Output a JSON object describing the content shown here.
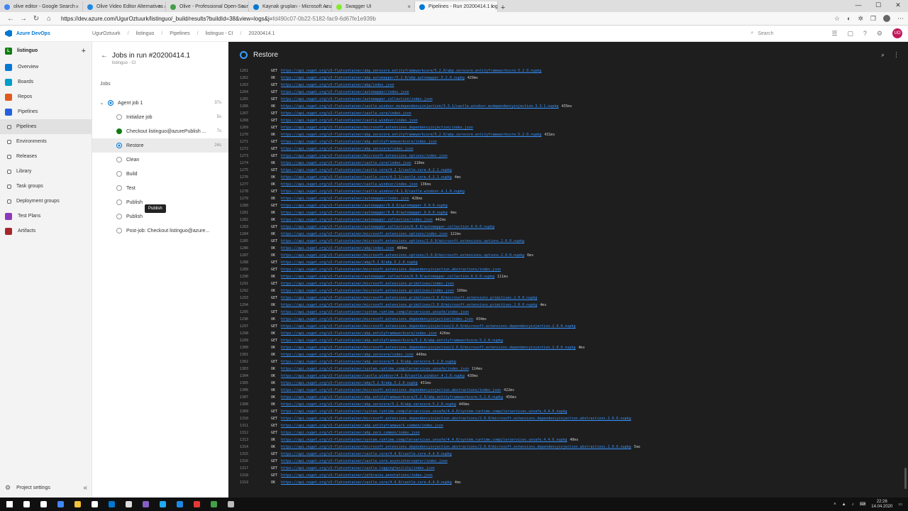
{
  "browser": {
    "tabs": [
      {
        "title": "olive editor - Google Search",
        "color": "#4285f4",
        "active": false
      },
      {
        "title": "Olive Video Editor Alternatives and...",
        "color": "#1e88e5",
        "active": false
      },
      {
        "title": "Olive - Professional Open-Source V...",
        "color": "#43a047",
        "active": false
      },
      {
        "title": "Kaynak grupları - Microsoft Azure",
        "color": "#0078d4",
        "active": false
      },
      {
        "title": "Swagger UI",
        "color": "#85ea2d",
        "active": false
      },
      {
        "title": "Pipelines - Run 20200414.1 logs",
        "color": "#0078d4",
        "active": true
      }
    ],
    "url_main": "https://dev.azure.com/UgurOztuurk/listinguo/_build/results?buildId=38&view=logs&j=",
    "url_rest": "fd490c07-0b22-5182-fac9-6d67fe1e939b"
  },
  "header": {
    "brand": "Azure DevOps",
    "breadcrumbs": [
      "UgurOztuurk",
      "listinguo",
      "Pipelines",
      "listinguo - CI",
      "20200414.1"
    ],
    "search_placeholder": "Search",
    "user_initials": "UO"
  },
  "leftnav": {
    "project_initial": "L",
    "project_name": "listinguo",
    "items": [
      {
        "label": "Overview",
        "color": "#0078d4",
        "sub": false,
        "selected": false
      },
      {
        "label": "Boards",
        "color": "#009ccc",
        "sub": false,
        "selected": false
      },
      {
        "label": "Repos",
        "color": "#e05b1f",
        "sub": false,
        "selected": false
      },
      {
        "label": "Pipelines",
        "color": "#2560e0",
        "sub": false,
        "selected": false
      },
      {
        "label": "Pipelines",
        "color": "#2560e0",
        "sub": true,
        "selected": true
      },
      {
        "label": "Environments",
        "color": "#555",
        "sub": true,
        "selected": false
      },
      {
        "label": "Releases",
        "color": "#555",
        "sub": true,
        "selected": false
      },
      {
        "label": "Library",
        "color": "#555",
        "sub": true,
        "selected": false
      },
      {
        "label": "Task groups",
        "color": "#555",
        "sub": true,
        "selected": false
      },
      {
        "label": "Deployment groups",
        "color": "#555",
        "sub": true,
        "selected": false
      },
      {
        "label": "Test Plans",
        "color": "#8a3ab9",
        "sub": false,
        "selected": false
      },
      {
        "label": "Artifacts",
        "color": "#a4262c",
        "sub": false,
        "selected": false
      }
    ],
    "project_settings": "Project settings"
  },
  "jobs": {
    "title": "Jobs in run #20200414.1",
    "subtitle": "listinguo - CI",
    "section_label": "Jobs",
    "agent_job": {
      "label": "Agent job 1",
      "duration": "37s"
    },
    "steps": [
      {
        "label": "Initialize job",
        "status": "skip",
        "duration": "5s",
        "selected": false
      },
      {
        "label": "Checkout listinguo@azurePublish ...",
        "status": "ok",
        "duration": "7s",
        "selected": false
      },
      {
        "label": "Restore",
        "status": "run",
        "duration": "24s",
        "selected": true
      },
      {
        "label": "Clean",
        "status": "pending",
        "duration": "",
        "selected": false
      },
      {
        "label": "Build",
        "status": "pending",
        "duration": "",
        "selected": false
      },
      {
        "label": "Test",
        "status": "pending",
        "duration": "",
        "selected": false
      },
      {
        "label": "Publish",
        "status": "pending",
        "duration": "",
        "selected": false
      },
      {
        "label": "Publish",
        "status": "pending",
        "duration": "",
        "selected": false
      },
      {
        "label": "Post-job: Checkout listinguo@azure...",
        "status": "pending",
        "duration": "",
        "selected": false
      }
    ],
    "tooltip": "Publish"
  },
  "log": {
    "title": "Restore",
    "lines": [
      {
        "n": "1261",
        "v": "GET",
        "u": "https://api.nuget.org/v3-flatcontainer/abp.zerocore.entityframeworkcore/5.2.0/abp.zerocore.entityframeworkcore.5.2.0.nupkg",
        "t": ""
      },
      {
        "n": "1262",
        "v": "OK",
        "u": "https://api.nuget.org/v3-flatcontainer/abp.automapper/5.2.0/abp.automapper.5.2.0.nupkg",
        "t": "429ms"
      },
      {
        "n": "1263",
        "v": "GET",
        "u": "https://api.nuget.org/v3-flatcontainer/abp/index.json",
        "t": ""
      },
      {
        "n": "1264",
        "v": "GET",
        "u": "https://api.nuget.org/v3-flatcontainer/automapper/index.json",
        "t": ""
      },
      {
        "n": "1265",
        "v": "GET",
        "u": "https://api.nuget.org/v3-flatcontainer/automapper.collection/index.json",
        "t": ""
      },
      {
        "n": "1266",
        "v": "OK",
        "u": "https://api.nuget.org/v3-flatcontainer/castle.windsor.msdependencyinjection/3.3.1/castle.windsor.msdependencyinjection.3.3.1.nupkg",
        "t": "435ms"
      },
      {
        "n": "1267",
        "v": "GET",
        "u": "https://api.nuget.org/v3-flatcontainer/castle.core/index.json",
        "t": ""
      },
      {
        "n": "1268",
        "v": "GET",
        "u": "https://api.nuget.org/v3-flatcontainer/castle.windsor/index.json",
        "t": ""
      },
      {
        "n": "1269",
        "v": "GET",
        "u": "https://api.nuget.org/v3-flatcontainer/microsoft.extensions.dependencyinjection/index.json",
        "t": ""
      },
      {
        "n": "1270",
        "v": "OK",
        "u": "https://api.nuget.org/v3-flatcontainer/abp.zerocore.entityframeworkcore/5.2.0/abp.zerocore.entityframeworkcore.5.2.0.nupkg",
        "t": "431ms"
      },
      {
        "n": "1271",
        "v": "GET",
        "u": "https://api.nuget.org/v3-flatcontainer/abp.entityframeworkcore/index.json",
        "t": ""
      },
      {
        "n": "1272",
        "v": "GET",
        "u": "https://api.nuget.org/v3-flatcontainer/abp.zerocore/index.json",
        "t": ""
      },
      {
        "n": "1273",
        "v": "GET",
        "u": "https://api.nuget.org/v3-flatcontainer/microsoft.extensions.options/index.json",
        "t": ""
      },
      {
        "n": "1274",
        "v": "OK",
        "u": "https://api.nuget.org/v3-flatcontainer/castle.core/index.json",
        "t": "110ms"
      },
      {
        "n": "1275",
        "v": "GET",
        "u": "https://api.nuget.org/v3-flatcontainer/castle.core/4.2.1/castle.core.4.2.1.nupkg",
        "t": ""
      },
      {
        "n": "1276",
        "v": "OK",
        "u": "https://api.nuget.org/v3-flatcontainer/castle.core/4.2.1/castle.core.4.2.1.nupkg",
        "t": "4ms"
      },
      {
        "n": "1277",
        "v": "OK",
        "u": "https://api.nuget.org/v3-flatcontainer/castle.windsor/index.json",
        "t": "136ms"
      },
      {
        "n": "1278",
        "v": "GET",
        "u": "https://api.nuget.org/v3-flatcontainer/castle.windsor/4.1.0/castle.windsor.4.1.0.nupkg",
        "t": ""
      },
      {
        "n": "1279",
        "v": "OK",
        "u": "https://api.nuget.org/v3-flatcontainer/automapper/index.json",
        "t": "428ms"
      },
      {
        "n": "1280",
        "v": "GET",
        "u": "https://api.nuget.org/v3-flatcontainer/automapper/9.0.0/automapper.9.0.0.nupkg",
        "t": ""
      },
      {
        "n": "1281",
        "v": "OK",
        "u": "https://api.nuget.org/v3-flatcontainer/automapper/9.0.0/automapper.9.0.0.nupkg",
        "t": "4ms"
      },
      {
        "n": "1282",
        "v": "OK",
        "u": "https://api.nuget.org/v3-flatcontainer/automapper.collection/index.json",
        "t": "442ms"
      },
      {
        "n": "1283",
        "v": "GET",
        "u": "https://api.nuget.org/v3-flatcontainer/automapper.collection/6.0.0/automapper.collection.6.0.0.nupkg",
        "t": ""
      },
      {
        "n": "1284",
        "v": "OK",
        "u": "https://api.nuget.org/v3-flatcontainer/microsoft.extensions.options/index.json",
        "t": "122ms"
      },
      {
        "n": "1285",
        "v": "GET",
        "u": "https://api.nuget.org/v3-flatcontainer/microsoft.extensions.options/2.0.0/microsoft.extensions.options.2.0.0.nupkg",
        "t": ""
      },
      {
        "n": "1286",
        "v": "OK",
        "u": "https://api.nuget.org/v3-flatcontainer/abp/index.json",
        "t": "489ms"
      },
      {
        "n": "1287",
        "v": "OK",
        "u": "https://api.nuget.org/v3-flatcontainer/microsoft.extensions.options/2.0.0/microsoft.extensions.options.2.0.0.nupkg",
        "t": "6ms"
      },
      {
        "n": "1288",
        "v": "GET",
        "u": "https://api.nuget.org/v3-flatcontainer/abp/5.2.0/abp.5.2.0.nupkg",
        "t": ""
      },
      {
        "n": "1289",
        "v": "GET",
        "u": "https://api.nuget.org/v3-flatcontainer/microsoft.extensions.dependencyinjection.abstractions/index.json",
        "t": ""
      },
      {
        "n": "1290",
        "v": "OK",
        "u": "https://api.nuget.org/v3-flatcontainer/automapper.collection/6.0.0/automapper.collection.6.0.0.nupkg",
        "t": "111ms"
      },
      {
        "n": "1291",
        "v": "GET",
        "u": "https://api.nuget.org/v3-flatcontainer/microsoft.extensions.primitives/index.json",
        "t": ""
      },
      {
        "n": "1292",
        "v": "OK",
        "u": "https://api.nuget.org/v3-flatcontainer/microsoft.extensions.primitives/index.json",
        "t": "109ms"
      },
      {
        "n": "1293",
        "v": "GET",
        "u": "https://api.nuget.org/v3-flatcontainer/microsoft.extensions.primitives/2.0.0/microsoft.extensions.primitives.2.0.0.nupkg",
        "t": ""
      },
      {
        "n": "1294",
        "v": "OK",
        "u": "https://api.nuget.org/v3-flatcontainer/microsoft.extensions.primitives/2.0.0/microsoft.extensions.primitives.2.0.0.nupkg",
        "t": "4ms"
      },
      {
        "n": "1295",
        "v": "GET",
        "u": "https://api.nuget.org/v3-flatcontainer/system.runtime.compilerservices.unsafe/index.json",
        "t": ""
      },
      {
        "n": "1296",
        "v": "OK",
        "u": "https://api.nuget.org/v3-flatcontainer/microsoft.extensions.dependencyinjection/index.json",
        "t": "434ms"
      },
      {
        "n": "1297",
        "v": "GET",
        "u": "https://api.nuget.org/v3-flatcontainer/microsoft.extensions.dependencyinjection/2.0.0/microsoft.extensions.dependencyinjection.2.0.0.nupkg",
        "t": ""
      },
      {
        "n": "1298",
        "v": "OK",
        "u": "https://api.nuget.org/v3-flatcontainer/abp.entityframeworkcore/index.json",
        "t": "426ms"
      },
      {
        "n": "1299",
        "v": "GET",
        "u": "https://api.nuget.org/v3-flatcontainer/abp.entityframeworkcore/5.2.0/abp.entityframeworkcore.5.2.0.nupkg",
        "t": ""
      },
      {
        "n": "1300",
        "v": "OK",
        "u": "https://api.nuget.org/v3-flatcontainer/microsoft.extensions.dependencyinjection/2.0.0/microsoft.extensions.dependencyinjection.2.0.0.nupkg",
        "t": "4ms"
      },
      {
        "n": "1301",
        "v": "OK",
        "u": "https://api.nuget.org/v3-flatcontainer/abp.zerocore/index.json",
        "t": "440ms"
      },
      {
        "n": "1302",
        "v": "GET",
        "u": "https://api.nuget.org/v3-flatcontainer/abp.zerocore/5.2.0/abp.zerocore.5.2.0.nupkg",
        "t": ""
      },
      {
        "n": "1303",
        "v": "OK",
        "u": "https://api.nuget.org/v3-flatcontainer/system.runtime.compilerservices.unsafe/index.json",
        "t": "114ms"
      },
      {
        "n": "1304",
        "v": "OK",
        "u": "https://api.nuget.org/v3-flatcontainer/castle.windsor/4.1.0/castle.windsor.4.1.0.nupkg",
        "t": "430ms"
      },
      {
        "n": "1305",
        "v": "OK",
        "u": "https://api.nuget.org/v3-flatcontainer/abp/5.2.0/abp.5.2.0.nupkg",
        "t": "431ms"
      },
      {
        "n": "1306",
        "v": "OK",
        "u": "https://api.nuget.org/v3-flatcontainer/microsoft.extensions.dependencyinjection.abstractions/index.json",
        "t": "422ms"
      },
      {
        "n": "1307",
        "v": "OK",
        "u": "https://api.nuget.org/v3-flatcontainer/abp.entityframeworkcore/5.2.0/abp.entityframeworkcore.5.2.0.nupkg",
        "t": "456ms"
      },
      {
        "n": "1308",
        "v": "OK",
        "u": "https://api.nuget.org/v3-flatcontainer/abp.zerocore/5.2.0/abp.zerocore.5.2.0.nupkg",
        "t": "449ms"
      },
      {
        "n": "1309",
        "v": "GET",
        "u": "https://api.nuget.org/v3-flatcontainer/system.runtime.compilerservices.unsafe/4.4.0/system.runtime.compilerservices.unsafe.4.4.0.nupkg",
        "t": ""
      },
      {
        "n": "1310",
        "v": "GET",
        "u": "https://api.nuget.org/v3-flatcontainer/microsoft.extensions.dependencyinjection.abstractions/2.0.0/microsoft.extensions.dependencyinjection.abstractions.2.0.0.nupkg",
        "t": ""
      },
      {
        "n": "1311",
        "v": "GET",
        "u": "https://api.nuget.org/v3-flatcontainer/abp.entityframework.common/index.json",
        "t": ""
      },
      {
        "n": "1312",
        "v": "GET",
        "u": "https://api.nuget.org/v3-flatcontainer/abp.zero.common/index.json",
        "t": ""
      },
      {
        "n": "1313",
        "v": "OK",
        "u": "https://api.nuget.org/v3-flatcontainer/system.runtime.compilerservices.unsafe/4.4.0/system.runtime.compilerservices.unsafe.4.4.0.nupkg",
        "t": "40ms"
      },
      {
        "n": "1314",
        "v": "OK",
        "u": "https://api.nuget.org/v3-flatcontainer/microsoft.extensions.dependencyinjection.abstractions/2.0.0/microsoft.extensions.dependencyinjection.abstractions.2.0.0.nupkg",
        "t": "5ms"
      },
      {
        "n": "1315",
        "v": "GET",
        "u": "https://api.nuget.org/v3-flatcontainer/castle.core/4.4.0/castle.core.4.4.0.nupkg",
        "t": ""
      },
      {
        "n": "1316",
        "v": "GET",
        "u": "https://api.nuget.org/v3-flatcontainer/castle.core.asyncinterceptor/index.json",
        "t": ""
      },
      {
        "n": "1317",
        "v": "GET",
        "u": "https://api.nuget.org/v3-flatcontainer/castle.loggingfacility/index.json",
        "t": ""
      },
      {
        "n": "1318",
        "v": "GET",
        "u": "https://api.nuget.org/v3-flatcontainer/jetbrains.annotations/index.json",
        "t": ""
      },
      {
        "n": "1319",
        "v": "OK",
        "u": "https://api.nuget.org/v3-flatcontainer/castle.core/4.4.0/castle.core.4.4.0.nupkg",
        "t": "4ms"
      }
    ]
  },
  "taskbar": {
    "apps": [
      {
        "name": "windows-start",
        "color": "#ffffff"
      },
      {
        "name": "search",
        "color": "#ffffff"
      },
      {
        "name": "task-view",
        "color": "#ffffff"
      },
      {
        "name": "chrome",
        "color": "#4285f4"
      },
      {
        "name": "file-explorer",
        "color": "#f3c13a"
      },
      {
        "name": "store",
        "color": "#ffffff"
      },
      {
        "name": "mail",
        "color": "#0078d4"
      },
      {
        "name": "obs",
        "color": "#dddddd"
      },
      {
        "name": "visual-studio",
        "color": "#865fc5"
      },
      {
        "name": "vscode",
        "color": "#23a9f2"
      },
      {
        "name": "app-blue",
        "color": "#1e88e5"
      },
      {
        "name": "app-red",
        "color": "#e53935"
      },
      {
        "name": "app-green",
        "color": "#43a047"
      },
      {
        "name": "app-misc",
        "color": "#bbbbbb"
      }
    ],
    "time": "22:26",
    "date": "14.04.2020"
  }
}
